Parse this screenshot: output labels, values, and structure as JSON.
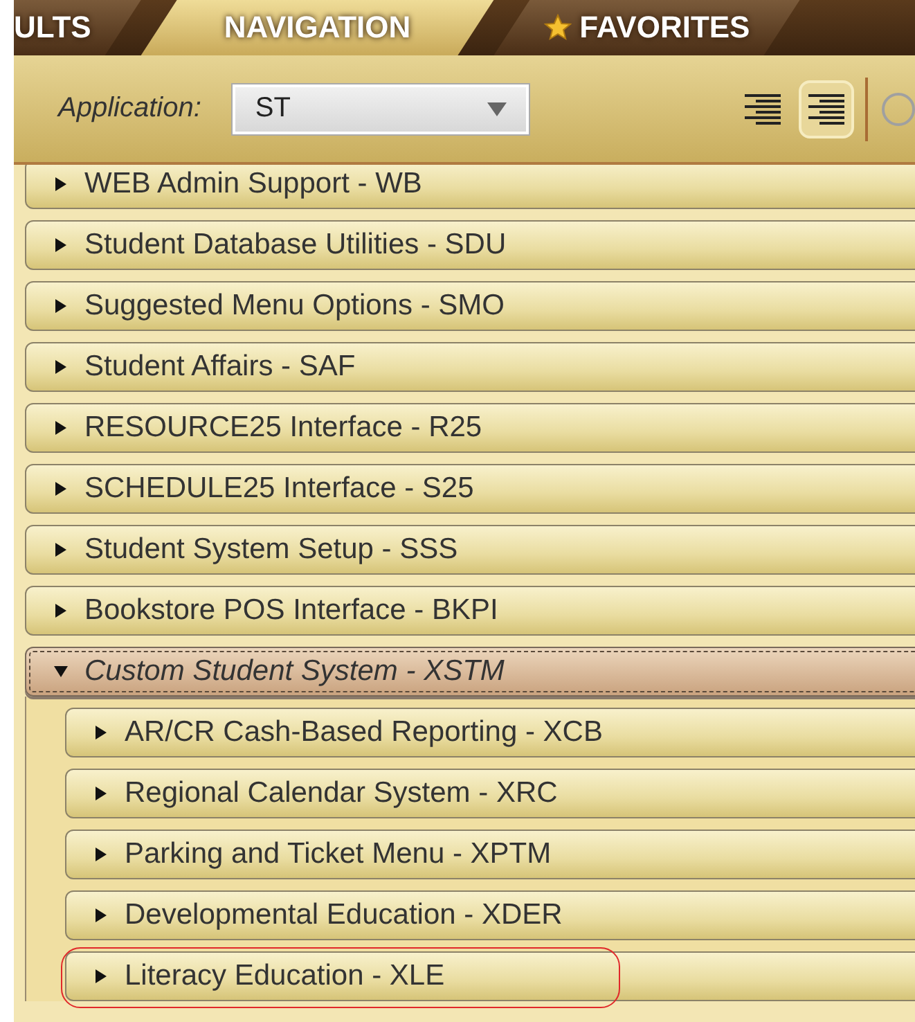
{
  "tabs": [
    {
      "label": "ULTS",
      "selected": false,
      "starred": false
    },
    {
      "label": "NAVIGATION",
      "selected": true,
      "starred": false
    },
    {
      "label": "FAVORITES",
      "selected": false,
      "starred": true
    }
  ],
  "toolbar": {
    "application_label": "Application:",
    "application_value": "ST",
    "view_buttons": [
      {
        "selected": false
      },
      {
        "selected": true
      }
    ]
  },
  "menu": [
    {
      "label": "WEB Admin Support - WB",
      "expanded": false,
      "highlighted": false
    },
    {
      "label": "Student Database Utilities - SDU",
      "expanded": false,
      "highlighted": false
    },
    {
      "label": "Suggested Menu Options - SMO",
      "expanded": false,
      "highlighted": false
    },
    {
      "label": "Student Affairs - SAF",
      "expanded": false,
      "highlighted": false
    },
    {
      "label": "RESOURCE25 Interface - R25",
      "expanded": false,
      "highlighted": false
    },
    {
      "label": "SCHEDULE25 Interface - S25",
      "expanded": false,
      "highlighted": false
    },
    {
      "label": "Student System Setup - SSS",
      "expanded": false,
      "highlighted": false
    },
    {
      "label": "Bookstore POS Interface - BKPI",
      "expanded": false,
      "highlighted": false
    },
    {
      "label": "Custom Student System - XSTM",
      "expanded": true,
      "highlighted": false,
      "children": [
        {
          "label": "AR/CR Cash-Based Reporting - XCB",
          "expanded": false,
          "highlighted": false
        },
        {
          "label": "Regional Calendar System - XRC",
          "expanded": false,
          "highlighted": false
        },
        {
          "label": "Parking and Ticket Menu - XPTM",
          "expanded": false,
          "highlighted": false
        },
        {
          "label": "Developmental Education - XDER",
          "expanded": false,
          "highlighted": false
        },
        {
          "label": "Literacy Education - XLE",
          "expanded": false,
          "highlighted": true
        }
      ]
    }
  ]
}
